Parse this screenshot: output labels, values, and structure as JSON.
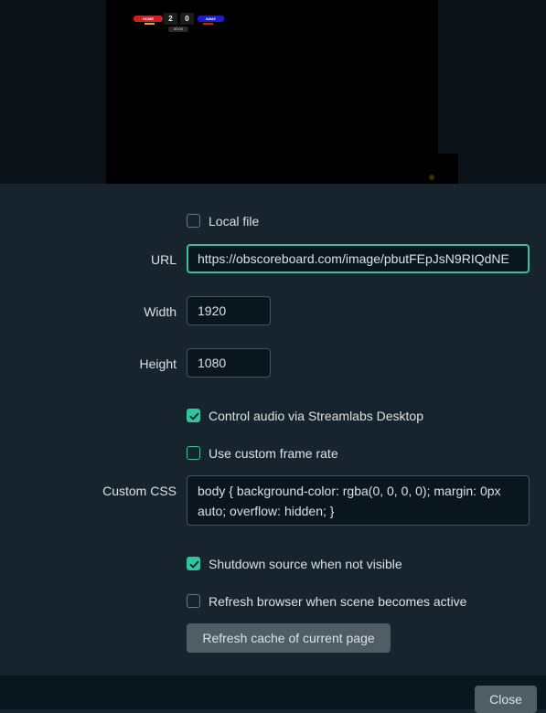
{
  "preview": {
    "scoreboard": {
      "home_team": "HOME",
      "away_team": "AWAY",
      "home_score": "2",
      "away_score": "0",
      "clock": "00:00"
    }
  },
  "form": {
    "local_file": {
      "label": "Local file",
      "checked": false
    },
    "url": {
      "label": "URL",
      "value": "https://obscoreboard.com/image/pbutFEpJsN9RIQdNE"
    },
    "width": {
      "label": "Width",
      "value": "1920"
    },
    "height": {
      "label": "Height",
      "value": "1080"
    },
    "control_audio": {
      "label": "Control audio via Streamlabs Desktop",
      "checked": true
    },
    "custom_frame_rate": {
      "label": "Use custom frame rate",
      "checked": false
    },
    "custom_css": {
      "label": "Custom CSS",
      "value": "body { background-color: rgba(0, 0, 0, 0); margin: 0px auto; overflow: hidden; }"
    },
    "shutdown_source": {
      "label": "Shutdown source when not visible",
      "checked": true
    },
    "refresh_browser": {
      "label": "Refresh browser when scene becomes active",
      "checked": false
    },
    "refresh_cache_button": "Refresh cache of current page"
  },
  "footer": {
    "close_button": "Close"
  },
  "colors": {
    "accent": "#31c3a2",
    "background": "#17242d",
    "input_bg": "#09161d",
    "button_bg": "#4f5e65"
  }
}
